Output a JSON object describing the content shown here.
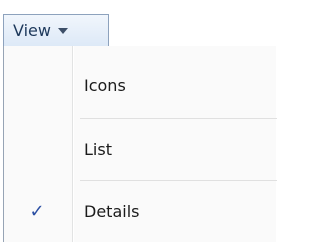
{
  "view_button": {
    "label": "View"
  },
  "menu": {
    "items": [
      {
        "label": "Icons",
        "checked": false
      },
      {
        "label": "List",
        "checked": false
      },
      {
        "label": "Details",
        "checked": true
      }
    ],
    "check_glyph": "✓"
  },
  "colors": {
    "check": "#2b4fa3",
    "button_text": "#1e395b"
  }
}
